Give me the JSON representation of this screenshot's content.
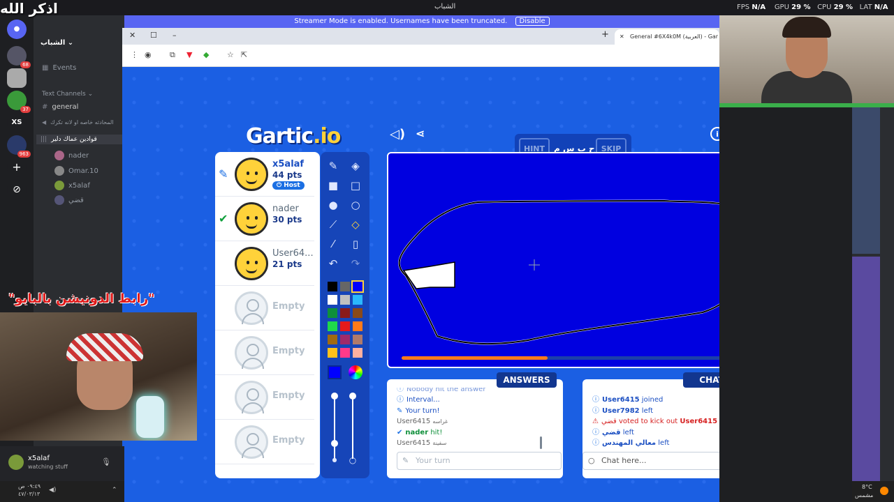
{
  "overlay": {
    "top_arabic": "اذكر الله",
    "donate_text": "\"رابط الدونيشن بالبايو\""
  },
  "os": {
    "app_title": "الشباب",
    "fps_label": "FPS",
    "fps": "N/A",
    "gpu_label": "GPU",
    "gpu": "29 %",
    "cpu_label": "CPU",
    "cpu": "29 %",
    "lat_label": "LAT",
    "lat": "N/A"
  },
  "discord": {
    "server_badges": [
      "68",
      "37",
      "963"
    ],
    "server_xs": "XS",
    "server_name": "الشباب",
    "events": "Events",
    "category": "Text Channels",
    "channels": [
      "general",
      "المحادثه خاصه او لانه تكرك",
      "قوادين عماك دلير"
    ],
    "voice_users": [
      "nader",
      "Omar.10",
      "x5alaf",
      "قضي"
    ],
    "user_name": "x5alaf",
    "user_status": "watching stuff",
    "clock": "٠٩:٤٩ ص",
    "date": "٤٧/٠٣/١٣"
  },
  "streamer": {
    "message": "Streamer Mode is enabled. Usernames have been truncated.",
    "disable": "Disable"
  },
  "browser": {
    "tab_title": "General #6X4k0M (العربية) - Gar"
  },
  "weather": {
    "temp": "8°C",
    "desc": "مشمس"
  },
  "game": {
    "hint_label": "HINT",
    "skip_label": "SKIP",
    "hint_word": "ح ب س م",
    "players": [
      {
        "name": "x5alaf",
        "points": "44 pts",
        "host": "Host",
        "state": "drawing"
      },
      {
        "name": "nader",
        "points": "30 pts",
        "state": "guessed"
      },
      {
        "name": "User64...",
        "points": "21 pts",
        "state": "none"
      },
      {
        "name": "Empty"
      },
      {
        "name": "Empty"
      },
      {
        "name": "Empty"
      },
      {
        "name": "Empty"
      }
    ],
    "timer_progress": 0.43,
    "answers_title": "ANSWERS",
    "chat_title": "CHAT",
    "answers": [
      {
        "text": "Nobody hit the answer",
        "kind": "info"
      },
      {
        "text": "Interval...",
        "kind": "info"
      },
      {
        "text": "Your turn!",
        "kind": "turn"
      },
      {
        "user": "User6415",
        "text": "غراسه",
        "kind": "guess"
      },
      {
        "user": "nader",
        "text": "hit!",
        "kind": "hit"
      },
      {
        "user": "User6415",
        "text": "سفينة",
        "kind": "guess"
      }
    ],
    "chat": [
      {
        "user": "User6415",
        "text": "joined",
        "kind": "info"
      },
      {
        "user": "User7982",
        "text": "left",
        "kind": "info"
      },
      {
        "user": "قضي",
        "text": "voted to kick out",
        "target": "User6415",
        "kind": "warn"
      },
      {
        "user": "قضي",
        "text": "left",
        "kind": "info"
      },
      {
        "user": "معالي المهندس",
        "text": "left",
        "kind": "info"
      }
    ],
    "answer_placeholder": "Your turn",
    "chat_placeholder": "Chat here...",
    "tab_key": "tab",
    "colors": [
      "#000000",
      "#666666",
      "#0000ff",
      "#ffffff",
      "#c0c0c0",
      "#2ab8ff",
      "#0e8f3a",
      "#8a1a1a",
      "#8a4a1a",
      "#1fd84a",
      "#e61a1a",
      "#ff7a1a",
      "#a06a10",
      "#a02a6a",
      "#b07a6a",
      "#ffc21a",
      "#ff3a8a",
      "#ffb0a0"
    ],
    "current_color": "#0000ff"
  }
}
